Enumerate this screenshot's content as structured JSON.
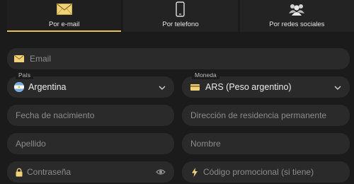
{
  "tabs": [
    {
      "label": "Por e-mail",
      "icon": "envelope-icon",
      "active": true
    },
    {
      "label": "Por telefono",
      "icon": "phone-icon",
      "active": false
    },
    {
      "label": "Por redes sociales",
      "icon": "people-icon",
      "active": false
    }
  ],
  "form": {
    "email_placeholder": "Email",
    "country_label": "País",
    "country_value": "Argentina",
    "currency_label": "Moneda",
    "currency_value": "ARS (Peso argentino)",
    "birthdate_placeholder": "Fecha de nacimiento",
    "address_placeholder": "Dirección de residencia permanente",
    "lastname_placeholder": "Apellido",
    "firstname_placeholder": "Nombre",
    "password_placeholder": "Contraseña",
    "promo_placeholder": "Código promocional (si tiene)"
  },
  "colors": {
    "accent": "#e8c15a",
    "field_bg": "#2a2a2a",
    "page_bg": "#1b1b1b"
  }
}
